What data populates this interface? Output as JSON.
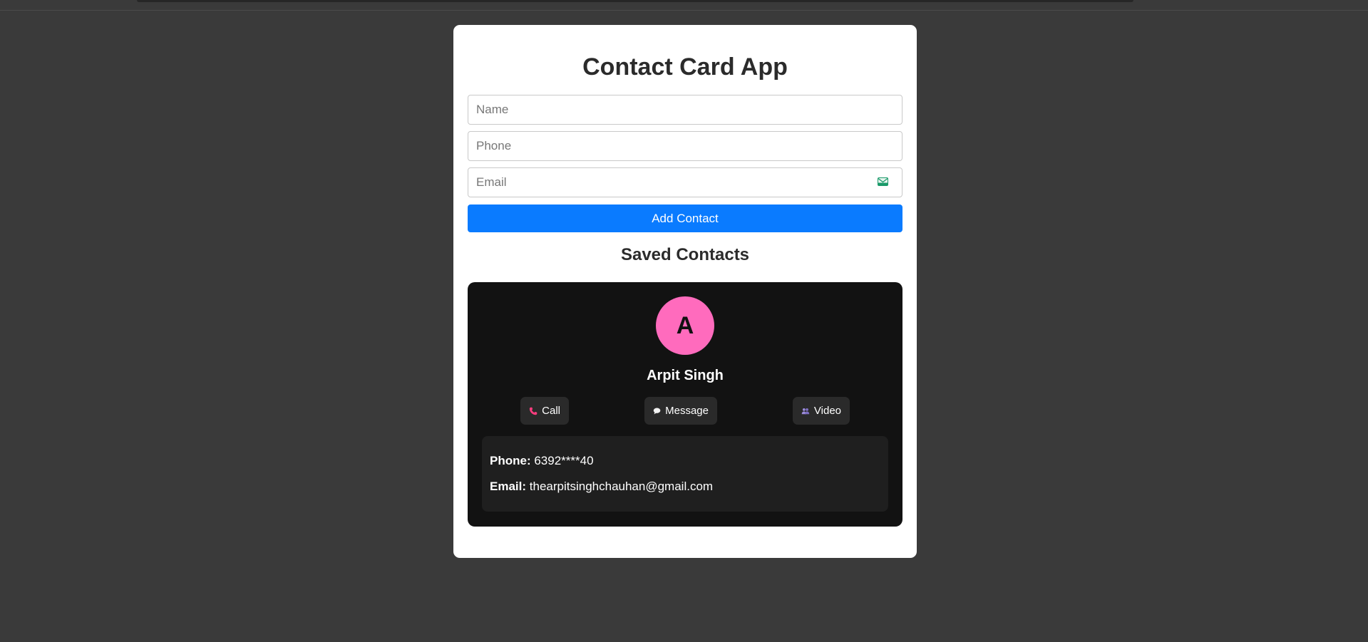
{
  "form": {
    "title": "Contact Card App",
    "name_placeholder": "Name",
    "phone_placeholder": "Phone",
    "email_placeholder": "Email",
    "email_icon": "envelope-icon",
    "add_button_label": "Add Contact"
  },
  "saved": {
    "title": "Saved Contacts"
  },
  "contact": {
    "initial": "A",
    "name": "Arpit Singh",
    "avatar_color": "#ff6bbd",
    "actions": {
      "call": "Call",
      "message": "Message",
      "video": "Video"
    },
    "phone_label": "Phone:",
    "phone": "6392****40",
    "email_label": "Email:",
    "email": "thearpitsinghchauhan@gmail.com"
  },
  "colors": {
    "accent": "#0a7bff",
    "background": "#3a3a3a",
    "card_dark": "#121212"
  }
}
